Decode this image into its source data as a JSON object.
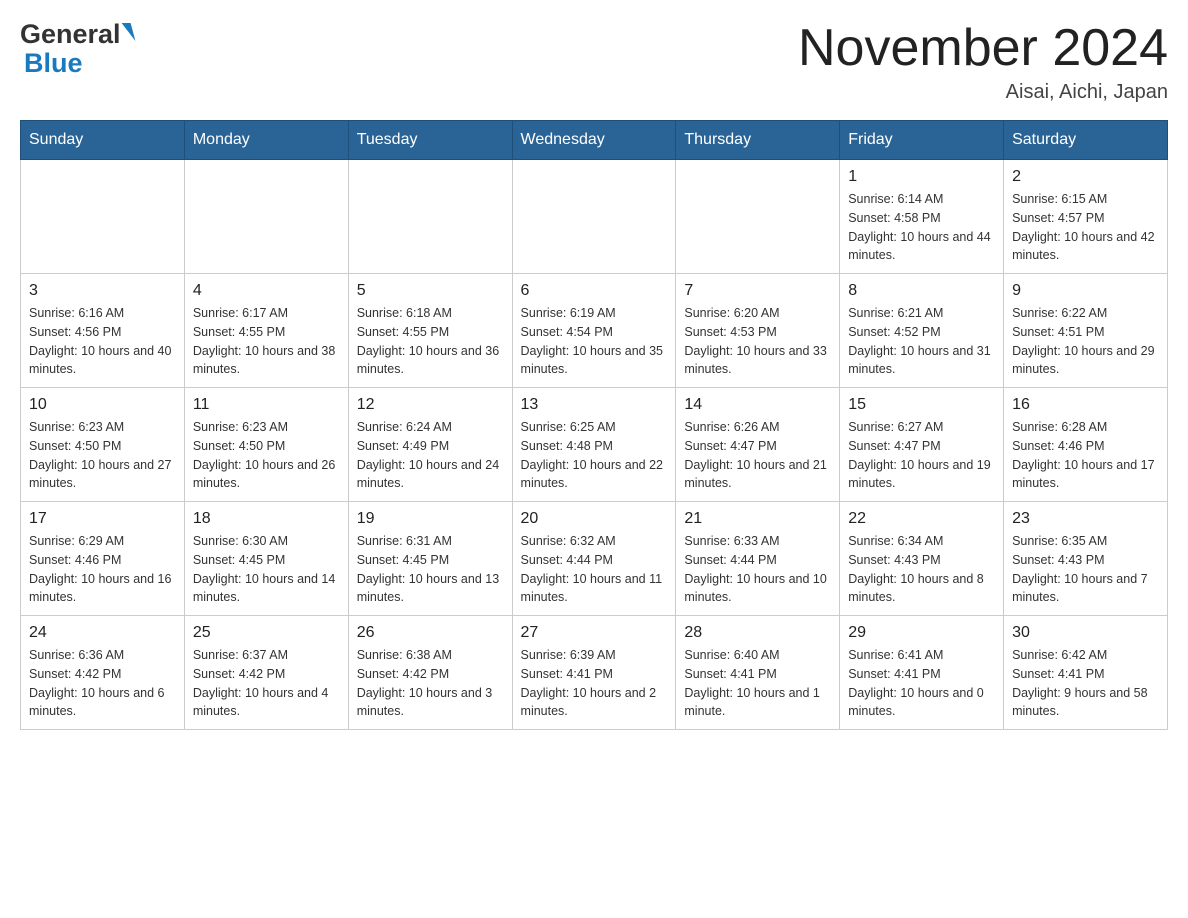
{
  "header": {
    "logo_line1": "General",
    "logo_line2": "Blue",
    "month_title": "November 2024",
    "location": "Aisai, Aichi, Japan"
  },
  "days_of_week": [
    "Sunday",
    "Monday",
    "Tuesday",
    "Wednesday",
    "Thursday",
    "Friday",
    "Saturday"
  ],
  "weeks": [
    {
      "days": [
        {
          "num": "",
          "info": "",
          "empty": true
        },
        {
          "num": "",
          "info": "",
          "empty": true
        },
        {
          "num": "",
          "info": "",
          "empty": true
        },
        {
          "num": "",
          "info": "",
          "empty": true
        },
        {
          "num": "",
          "info": "",
          "empty": true
        },
        {
          "num": "1",
          "info": "Sunrise: 6:14 AM\nSunset: 4:58 PM\nDaylight: 10 hours and 44 minutes.",
          "empty": false
        },
        {
          "num": "2",
          "info": "Sunrise: 6:15 AM\nSunset: 4:57 PM\nDaylight: 10 hours and 42 minutes.",
          "empty": false
        }
      ]
    },
    {
      "days": [
        {
          "num": "3",
          "info": "Sunrise: 6:16 AM\nSunset: 4:56 PM\nDaylight: 10 hours and 40 minutes.",
          "empty": false
        },
        {
          "num": "4",
          "info": "Sunrise: 6:17 AM\nSunset: 4:55 PM\nDaylight: 10 hours and 38 minutes.",
          "empty": false
        },
        {
          "num": "5",
          "info": "Sunrise: 6:18 AM\nSunset: 4:55 PM\nDaylight: 10 hours and 36 minutes.",
          "empty": false
        },
        {
          "num": "6",
          "info": "Sunrise: 6:19 AM\nSunset: 4:54 PM\nDaylight: 10 hours and 35 minutes.",
          "empty": false
        },
        {
          "num": "7",
          "info": "Sunrise: 6:20 AM\nSunset: 4:53 PM\nDaylight: 10 hours and 33 minutes.",
          "empty": false
        },
        {
          "num": "8",
          "info": "Sunrise: 6:21 AM\nSunset: 4:52 PM\nDaylight: 10 hours and 31 minutes.",
          "empty": false
        },
        {
          "num": "9",
          "info": "Sunrise: 6:22 AM\nSunset: 4:51 PM\nDaylight: 10 hours and 29 minutes.",
          "empty": false
        }
      ]
    },
    {
      "days": [
        {
          "num": "10",
          "info": "Sunrise: 6:23 AM\nSunset: 4:50 PM\nDaylight: 10 hours and 27 minutes.",
          "empty": false
        },
        {
          "num": "11",
          "info": "Sunrise: 6:23 AM\nSunset: 4:50 PM\nDaylight: 10 hours and 26 minutes.",
          "empty": false
        },
        {
          "num": "12",
          "info": "Sunrise: 6:24 AM\nSunset: 4:49 PM\nDaylight: 10 hours and 24 minutes.",
          "empty": false
        },
        {
          "num": "13",
          "info": "Sunrise: 6:25 AM\nSunset: 4:48 PM\nDaylight: 10 hours and 22 minutes.",
          "empty": false
        },
        {
          "num": "14",
          "info": "Sunrise: 6:26 AM\nSunset: 4:47 PM\nDaylight: 10 hours and 21 minutes.",
          "empty": false
        },
        {
          "num": "15",
          "info": "Sunrise: 6:27 AM\nSunset: 4:47 PM\nDaylight: 10 hours and 19 minutes.",
          "empty": false
        },
        {
          "num": "16",
          "info": "Sunrise: 6:28 AM\nSunset: 4:46 PM\nDaylight: 10 hours and 17 minutes.",
          "empty": false
        }
      ]
    },
    {
      "days": [
        {
          "num": "17",
          "info": "Sunrise: 6:29 AM\nSunset: 4:46 PM\nDaylight: 10 hours and 16 minutes.",
          "empty": false
        },
        {
          "num": "18",
          "info": "Sunrise: 6:30 AM\nSunset: 4:45 PM\nDaylight: 10 hours and 14 minutes.",
          "empty": false
        },
        {
          "num": "19",
          "info": "Sunrise: 6:31 AM\nSunset: 4:45 PM\nDaylight: 10 hours and 13 minutes.",
          "empty": false
        },
        {
          "num": "20",
          "info": "Sunrise: 6:32 AM\nSunset: 4:44 PM\nDaylight: 10 hours and 11 minutes.",
          "empty": false
        },
        {
          "num": "21",
          "info": "Sunrise: 6:33 AM\nSunset: 4:44 PM\nDaylight: 10 hours and 10 minutes.",
          "empty": false
        },
        {
          "num": "22",
          "info": "Sunrise: 6:34 AM\nSunset: 4:43 PM\nDaylight: 10 hours and 8 minutes.",
          "empty": false
        },
        {
          "num": "23",
          "info": "Sunrise: 6:35 AM\nSunset: 4:43 PM\nDaylight: 10 hours and 7 minutes.",
          "empty": false
        }
      ]
    },
    {
      "days": [
        {
          "num": "24",
          "info": "Sunrise: 6:36 AM\nSunset: 4:42 PM\nDaylight: 10 hours and 6 minutes.",
          "empty": false
        },
        {
          "num": "25",
          "info": "Sunrise: 6:37 AM\nSunset: 4:42 PM\nDaylight: 10 hours and 4 minutes.",
          "empty": false
        },
        {
          "num": "26",
          "info": "Sunrise: 6:38 AM\nSunset: 4:42 PM\nDaylight: 10 hours and 3 minutes.",
          "empty": false
        },
        {
          "num": "27",
          "info": "Sunrise: 6:39 AM\nSunset: 4:41 PM\nDaylight: 10 hours and 2 minutes.",
          "empty": false
        },
        {
          "num": "28",
          "info": "Sunrise: 6:40 AM\nSunset: 4:41 PM\nDaylight: 10 hours and 1 minute.",
          "empty": false
        },
        {
          "num": "29",
          "info": "Sunrise: 6:41 AM\nSunset: 4:41 PM\nDaylight: 10 hours and 0 minutes.",
          "empty": false
        },
        {
          "num": "30",
          "info": "Sunrise: 6:42 AM\nSunset: 4:41 PM\nDaylight: 9 hours and 58 minutes.",
          "empty": false
        }
      ]
    }
  ]
}
